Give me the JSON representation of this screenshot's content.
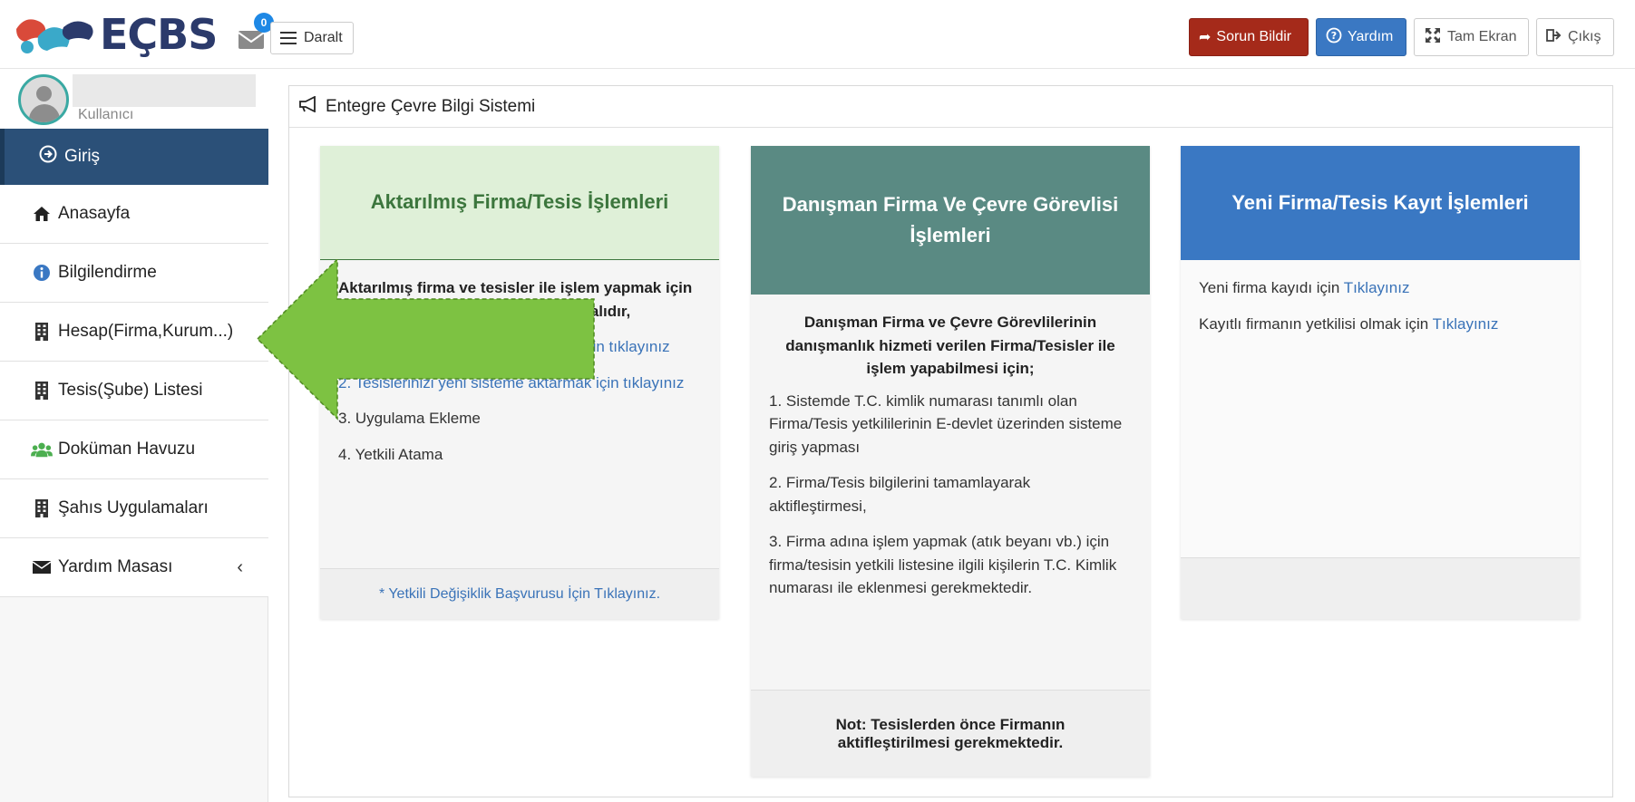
{
  "header": {
    "logo_text": "EÇBS",
    "mail_count": "0",
    "daralt_label": "Daralt",
    "buttons": {
      "sorun": "Sorun Bildir",
      "yardim": "Yardım",
      "tam_ekran": "Tam Ekran",
      "cikis": "Çıkış"
    }
  },
  "sidebar": {
    "user_label": "Kullanıcı",
    "active_item": "Giriş",
    "items": [
      {
        "label": "Anasayfa",
        "icon": "home-icon"
      },
      {
        "label": "Bilgilendirme",
        "icon": "info-icon"
      },
      {
        "label": "Hesap(Firma,Kurum...)",
        "icon": "building-icon"
      },
      {
        "label": "Tesis(Şube) Listesi",
        "icon": "building-icon"
      },
      {
        "label": "Doküman Havuzu",
        "icon": "users-icon"
      },
      {
        "label": "Şahıs Uygulamaları",
        "icon": "building-icon"
      },
      {
        "label": "Yardım Masası",
        "icon": "envelope-icon"
      }
    ]
  },
  "panel": {
    "title": "Entegre Çevre Bilgi Sistemi"
  },
  "cards": {
    "aktarilmis": {
      "title": "Aktarılmış Firma/Tesis İşlemleri",
      "intro": "Aktarılmış firma ve tesisler ile işlem yapmak için aşağıdaki işlemler sırası ile yapılmalıdır,",
      "step1": "1. Firmanızı yeni sisteme aktarmak için tıklayınız",
      "step2": "2. Tesislerinizi yeni sisteme aktarmak için tıklayınız",
      "step3": "3. Uygulama Ekleme",
      "step4": "4. Yetkili Atama",
      "footer_link": "* Yetkili Değişiklik Başvurusu İçin Tıklayınız."
    },
    "danisman": {
      "title": "Danışman Firma Ve Çevre Görevlisi İşlemleri",
      "intro": "Danışman Firma ve Çevre Görevlilerinin danışmanlık hizmeti verilen Firma/Tesisler ile işlem yapabilmesi için;",
      "step1": "1. Sistemde T.C. kimlik numarası tanımlı olan Firma/Tesis yetkililerinin E-devlet üzerinden sisteme giriş yapması",
      "step2": "2. Firma/Tesis bilgilerini tamamlayarak aktifleştirmesi,",
      "step3": "3. Firma adına işlem yapmak (atık beyanı vb.) için firma/tesisin yetkili listesine ilgili kişilerin T.C. Kimlik numarası ile eklenmesi gerekmektedir.",
      "note": "Not: Tesislerden önce Firmanın aktifleştirilmesi gerekmektedir."
    },
    "yeni": {
      "title": "Yeni Firma/Tesis Kayıt İşlemleri",
      "line1_text": "Yeni firma kayıdı için",
      "line1_link": "Tıklayınız",
      "line2_text": "Kayıtlı firmanın yetkilisi olmak için",
      "line2_link": "Tıklayınız"
    }
  },
  "colors": {
    "sidebar_active": "#2b5078",
    "arrow": "#7dc242",
    "sorun": "#a52a1a",
    "yardim": "#3a78c3",
    "card1_head": "#dff0d8",
    "card2_head": "#5a8a83",
    "card3_head": "#3a78c3"
  }
}
